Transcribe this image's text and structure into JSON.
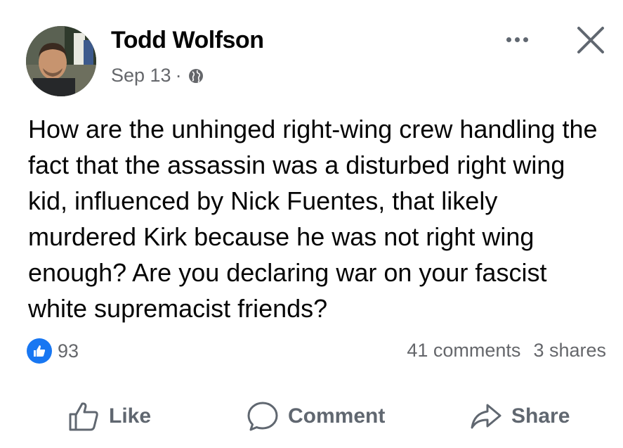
{
  "post": {
    "author": "Todd Wolfson",
    "date": "Sep 13",
    "separator": "·",
    "privacy_icon": "globe-icon",
    "text": "How are the unhinged right-wing crew handling the fact that the assassin was a disturbed right wing kid, influenced by Nick Fuentes, that likely murdered Kirk because he was not right wing enough?  Are you declaring war on your fascist white supremacist friends?"
  },
  "engagement": {
    "reaction_icon": "like-reaction-icon",
    "reaction_count": "93",
    "comments": "41 comments",
    "shares": "3 shares"
  },
  "actions": {
    "like": "Like",
    "comment": "Comment",
    "share": "Share"
  },
  "colors": {
    "accent": "#1877f2",
    "secondary_text": "#65676b",
    "primary_text": "#050505"
  }
}
